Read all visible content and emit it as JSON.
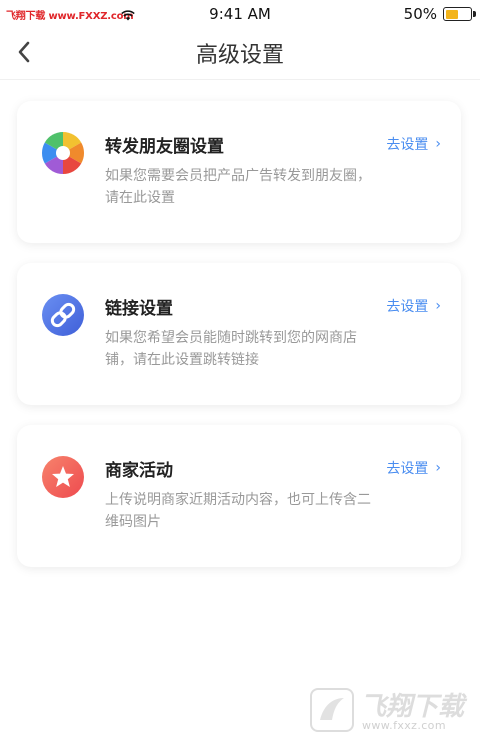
{
  "status_bar": {
    "carrier": "飞翔下载 www.FXXZ.com",
    "time": "9:41 AM",
    "battery_percent": "50%",
    "battery_level": 0.5
  },
  "nav": {
    "title": "高级设置"
  },
  "cards": [
    {
      "icon": "aperture-icon",
      "title": "转发朋友圈设置",
      "desc": "如果您需要会员把产品广告转发到朋友圈，请在此设置",
      "action": "去设置"
    },
    {
      "icon": "link-icon",
      "title": "链接设置",
      "desc": "如果您希望会员能随时跳转到您的网商店铺，请在此设置跳转链接",
      "action": "去设置"
    },
    {
      "icon": "star-icon",
      "title": "商家活动",
      "desc": "上传说明商家近期活动内容，也可上传含二维码图片",
      "action": "去设置"
    }
  ],
  "watermark": {
    "title": "飞翔下载",
    "url": "www.fxxz.com"
  },
  "colors": {
    "accent": "#4a8df0",
    "battery": "#f3b41b",
    "link_icon": "#4f76e6",
    "star_icon": "#f1605a"
  }
}
